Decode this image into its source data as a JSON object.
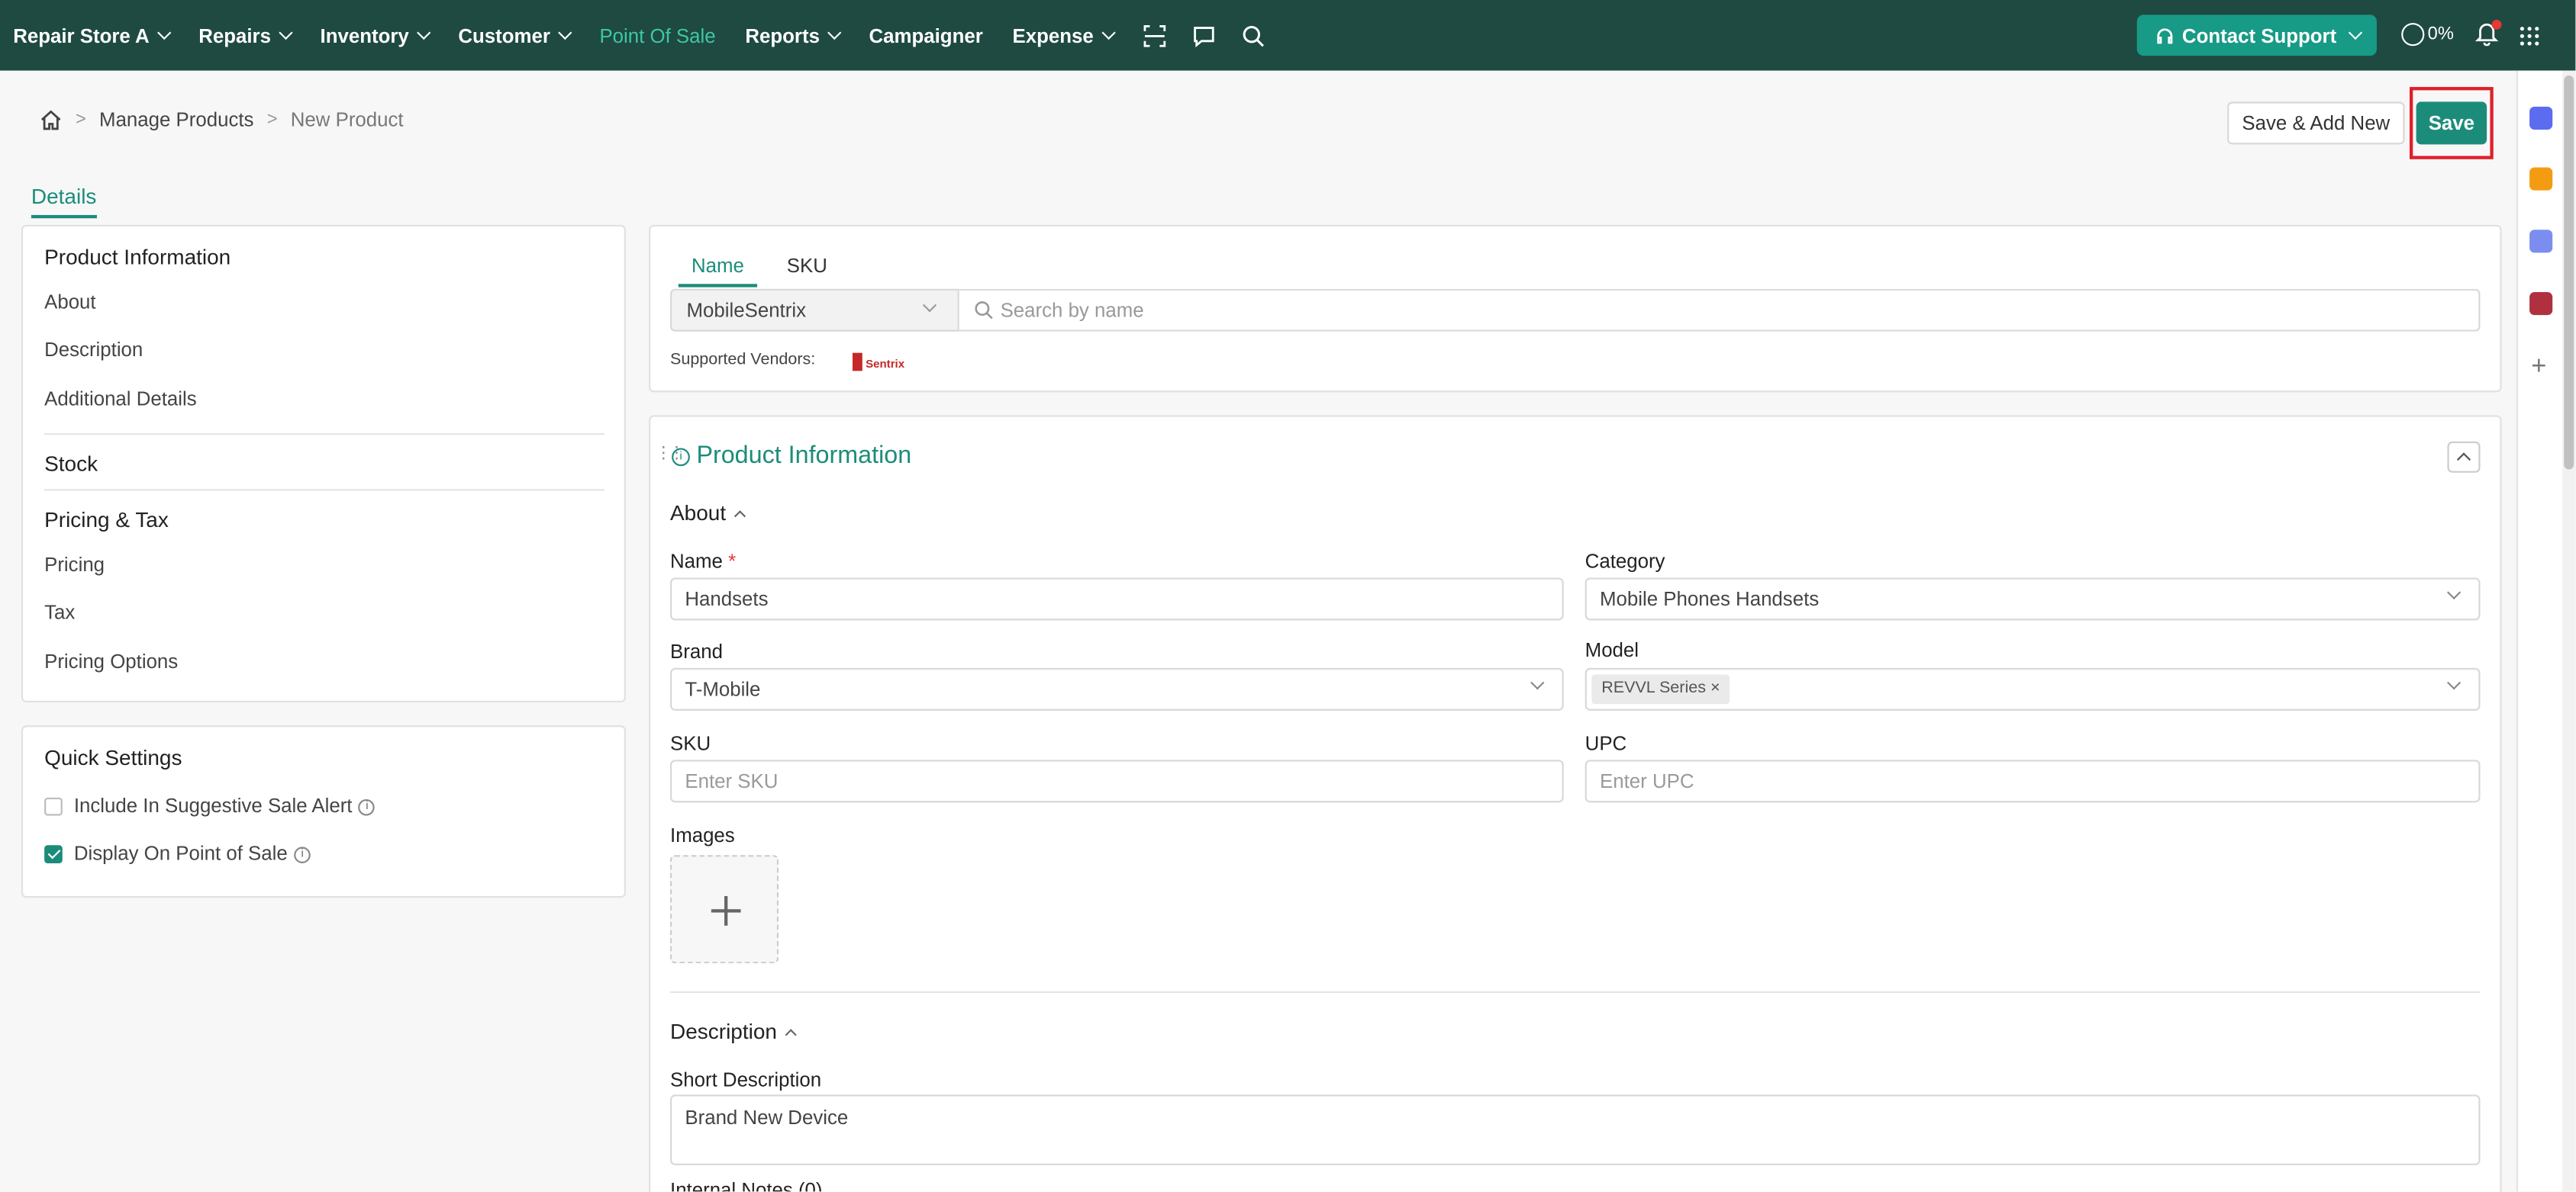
{
  "nav": {
    "store": "Repair Store A",
    "items": [
      "Repairs",
      "Inventory",
      "Customer",
      "Point Of Sale",
      "Reports",
      "Campaigner",
      "Expense"
    ],
    "support": "Contact Support",
    "progress": "0%"
  },
  "breadcrumb": {
    "parent": "Manage Products",
    "current": "New Product"
  },
  "actions": {
    "save_add": "Save & Add New",
    "save": "Save"
  },
  "tabs": {
    "details": "Details"
  },
  "left_nav": {
    "product_info": "Product Information",
    "about": "About",
    "description": "Description",
    "additional": "Additional Details",
    "stock": "Stock",
    "pricing_tax": "Pricing & Tax",
    "pricing": "Pricing",
    "tax": "Tax",
    "pricing_options": "Pricing Options"
  },
  "quick_settings": {
    "title": "Quick Settings",
    "suggestive": "Include In Suggestive Sale Alert",
    "display_pos": "Display On Point of Sale",
    "suggestive_checked": false,
    "display_pos_checked": true
  },
  "search": {
    "tab_name": "Name",
    "tab_sku": "SKU",
    "vendor": "MobileSentrix",
    "placeholder": "Search by name",
    "supported_label": "Supported Vendors:",
    "vendor_logo_text": "mobile Sentrix"
  },
  "form": {
    "section_title": "Product Information",
    "about": "About",
    "name_label": "Name",
    "required_mark": "*",
    "name_value": "Handsets",
    "category_label": "Category",
    "category_value": "Mobile Phones Handsets",
    "brand_label": "Brand",
    "brand_value": "T-Mobile",
    "model_label": "Model",
    "model_tag": "REVVL Series",
    "sku_label": "SKU",
    "sku_placeholder": "Enter SKU",
    "upc_label": "UPC",
    "upc_placeholder": "Enter UPC",
    "images_label": "Images",
    "description_head": "Description",
    "short_desc_label": "Short Description",
    "short_desc_value": "Brand New Device",
    "internal_notes_label": "Internal Notes (0)"
  },
  "colors": {
    "nav_bg": "#1e4a41",
    "accent": "#1c8c7a",
    "highlight": "#e0202a"
  }
}
